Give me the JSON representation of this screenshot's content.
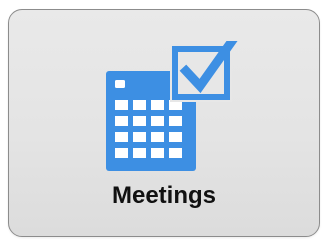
{
  "tile": {
    "label": "Meetings",
    "icon": "calendar-check-icon"
  },
  "colors": {
    "accent": "#3d8fe3",
    "background": "#e6e6e6",
    "border": "#8c8c8c",
    "text": "#111111"
  }
}
